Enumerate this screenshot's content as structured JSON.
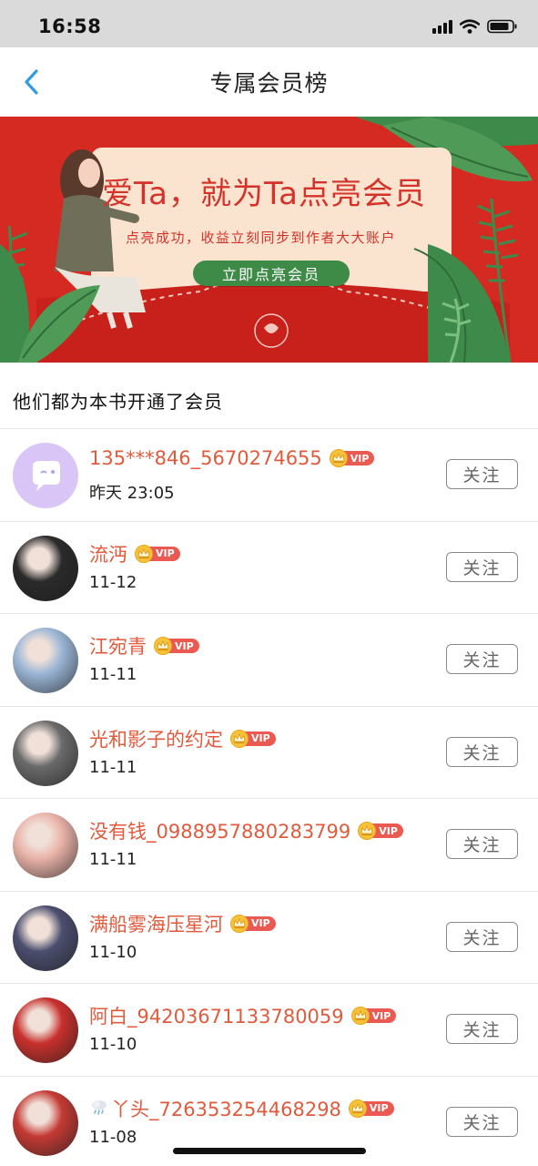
{
  "status_bar": {
    "time": "16:58"
  },
  "nav": {
    "title": "专属会员榜"
  },
  "banner": {
    "headline": "爱Ta，就为Ta点亮会员",
    "subtitle": "点亮成功，收益立刻同步到作者大大账户",
    "cta_label": "立即点亮会员"
  },
  "section_title": "他们都为本书开通了会员",
  "vip_label": "VIP",
  "follow_label": "关注",
  "members": [
    {
      "name": "135***846_5670274655",
      "date": "昨天 23:05",
      "avatar_color": "#d9c6f7"
    },
    {
      "name": "流沔",
      "date": "11-12",
      "avatar_color": "#2a2a2a"
    },
    {
      "name": "江宛青",
      "date": "11-11",
      "avatar_color": "#9bb6d6"
    },
    {
      "name": "光和影子的约定",
      "date": "11-11",
      "avatar_color": "#6a6a6a"
    },
    {
      "name": "没有钱_0988957880283799",
      "date": "11-11",
      "avatar_color": "#e9b3a8"
    },
    {
      "name": "满船雾海压星河",
      "date": "11-10",
      "avatar_color": "#4b4e6e"
    },
    {
      "name": "阿白_94203671133780059",
      "date": "11-10",
      "avatar_color": "#c8302c"
    },
    {
      "name": "丫头_726353254468298",
      "date": "11-08",
      "avatar_color": "#c43a34",
      "prefix_icon": "cloud-rain-icon"
    }
  ],
  "colors": {
    "accent_red": "#e25a3c",
    "banner_red": "#d42a22",
    "cta_green": "#3e8a47",
    "back_blue": "#2f9be0"
  }
}
